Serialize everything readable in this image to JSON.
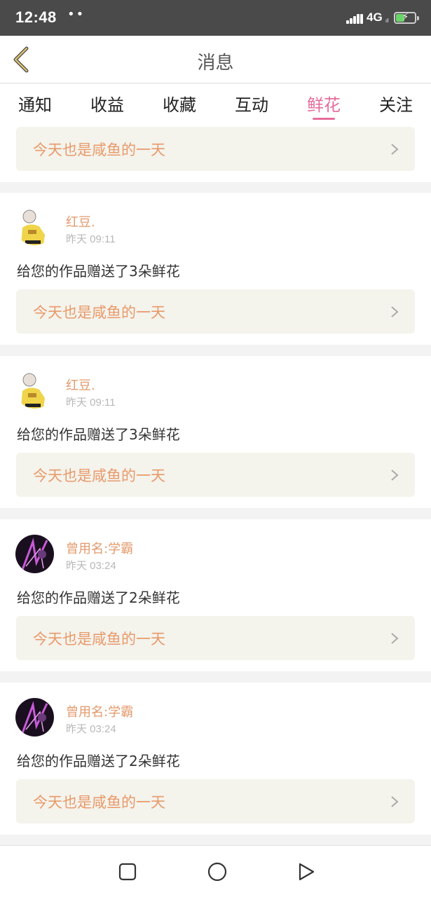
{
  "status": {
    "time": "12:48",
    "dots": "••",
    "network": "4G",
    "network_sub": "ıl"
  },
  "header": {
    "title": "消息",
    "back_icon": "chevron-left-icon"
  },
  "tabs": [
    {
      "label": "通知"
    },
    {
      "label": "收益"
    },
    {
      "label": "收藏"
    },
    {
      "label": "互动"
    },
    {
      "label": "鲜花",
      "active": true
    },
    {
      "label": "关注"
    }
  ],
  "colors": {
    "accent": "#e66d9c",
    "name": "#e39a6c",
    "link_text": "#e89a6a",
    "link_bg": "#f4f3ec"
  },
  "top_partial": {
    "work_title": "今天也是咸鱼的一天"
  },
  "messages": [
    {
      "name": "红豆.",
      "time": "昨天 09:11",
      "text": "给您的作品赠送了3朵鲜花",
      "work_title": "今天也是咸鱼的一天",
      "avatar": "yellow-anime-avatar"
    },
    {
      "name": "红豆.",
      "time": "昨天 09:11",
      "text": "给您的作品赠送了3朵鲜花",
      "work_title": "今天也是咸鱼的一天",
      "avatar": "yellow-anime-avatar"
    },
    {
      "name": "曾用名:学霸",
      "time": "昨天 03:24",
      "text": "给您的作品赠送了2朵鲜花",
      "work_title": "今天也是咸鱼的一天",
      "avatar": "purple-dark-avatar"
    },
    {
      "name": "曾用名:学霸",
      "time": "昨天 03:24",
      "text": "给您的作品赠送了2朵鲜花",
      "work_title": "今天也是咸鱼的一天",
      "avatar": "purple-dark-avatar"
    }
  ],
  "nav": {
    "recent": "square-icon",
    "home": "circle-icon",
    "back": "triangle-icon"
  }
}
